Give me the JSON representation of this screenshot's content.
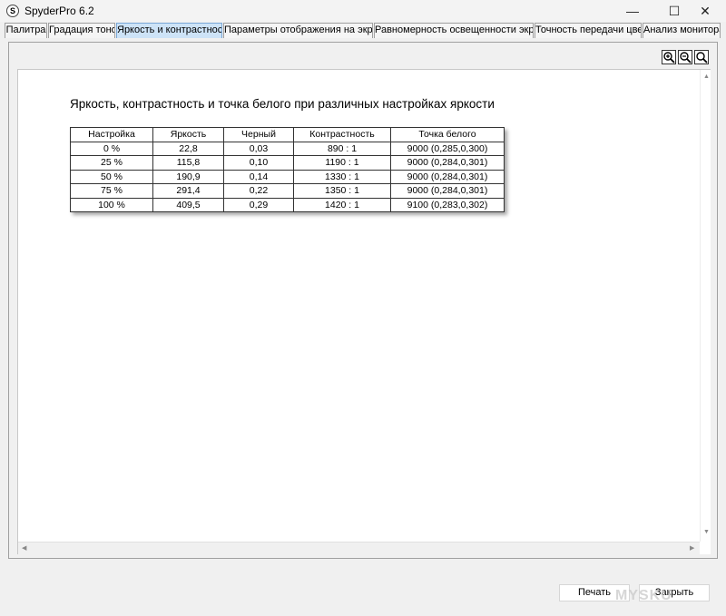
{
  "window": {
    "title": "SpyderPro 6.2",
    "icon_letter": "S",
    "minimize_glyph": "—",
    "maximize_glyph": "☐",
    "close_glyph": "✕"
  },
  "tabs": [
    {
      "label": "Палитра",
      "active": false
    },
    {
      "label": "Градация тонов",
      "active": false
    },
    {
      "label": "Яркость и контрастность",
      "active": true
    },
    {
      "label": "Параметры отображения на экране",
      "active": false
    },
    {
      "label": "Равномерность освещенности экрана",
      "active": false
    },
    {
      "label": "Точность передачи цвета",
      "active": false
    },
    {
      "label": "Анализ монитора",
      "active": false
    }
  ],
  "zoom": {
    "zoom_in_icon": "zoom-in-icon",
    "zoom_out_icon": "zoom-out-icon",
    "zoom_fit_icon": "zoom-fit-icon"
  },
  "report": {
    "title": "Яркость, контрастность и точка белого при различных настройках яркости",
    "columns": [
      "Настройка",
      "Яркость",
      "Черный",
      "Контрастность",
      "Точка белого"
    ],
    "rows": [
      [
        "0 %",
        "22,8",
        "0,03",
        "890 : 1",
        "9000 (0,285,0,300)"
      ],
      [
        "25 %",
        "115,8",
        "0,10",
        "1190 : 1",
        "9000 (0,284,0,301)"
      ],
      [
        "50 %",
        "190,9",
        "0,14",
        "1330 : 1",
        "9000 (0,284,0,301)"
      ],
      [
        "75 %",
        "291,4",
        "0,22",
        "1350 : 1",
        "9000 (0,284,0,301)"
      ],
      [
        "100 %",
        "409,5",
        "0,29",
        "1420 : 1",
        "9100 (0,283,0,302)"
      ]
    ]
  },
  "buttons": {
    "print_label": "Печать",
    "close_label": "Закрыть"
  },
  "watermark": "MYSKU"
}
